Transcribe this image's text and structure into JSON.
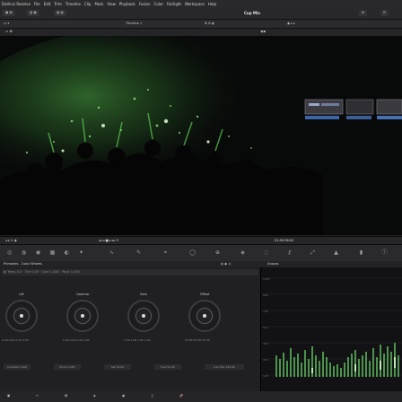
{
  "menubar": {
    "items": [
      "DaVinci Resolve",
      "File",
      "Edit",
      "Trim",
      "Timeline",
      "Clip",
      "Mark",
      "View",
      "Playback",
      "Fusion",
      "Color",
      "Fairlight",
      "Workspace",
      "Help"
    ]
  },
  "toolbar": {
    "project_name": "Cup Mix",
    "timeline_label": "Timeline 1",
    "zoom_label": "38%"
  },
  "panel": {
    "timecode": "01:00:58:02",
    "wheels_title": "Primaries - Color Wheels",
    "scopes_title": "Scopes",
    "wheel_labels": [
      "Lift",
      "Gamma",
      "Gain",
      "Offset"
    ],
    "wheel_values": [
      "0.00 0.00 0.00 0.00",
      "0.00 0.00 0.00 0.00",
      "1.00 1.00 1.00 1.00",
      "25.00 25.00 25.00"
    ],
    "params": [
      "Contrast 1.000",
      "Pivot 0.435",
      "Sat 50.00",
      "Hue 50.00",
      "Lum Mix 100.00"
    ]
  },
  "colors": {
    "accent": "#3a7bd5",
    "scope_green": "#7cff7c",
    "bg": "#1e1e20"
  }
}
